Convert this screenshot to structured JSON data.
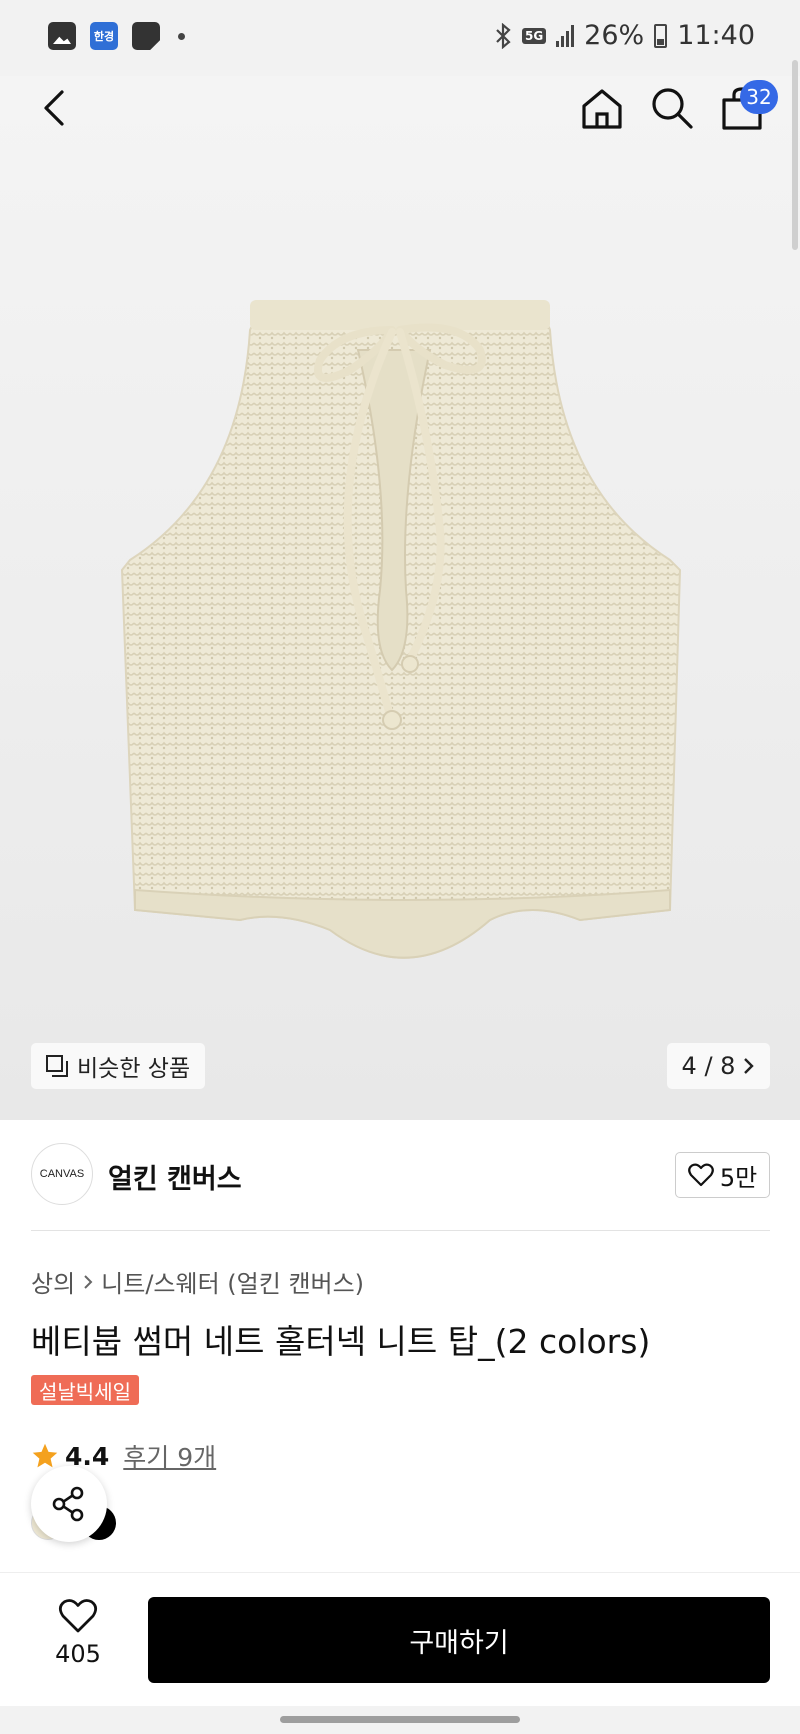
{
  "status_bar": {
    "hk_label": "한경",
    "network": "5G",
    "battery": "26%",
    "time": "11:40"
  },
  "header": {
    "cart_count": "32"
  },
  "gallery": {
    "similar_label": "비슷한 상품",
    "page_indicator": "4 / 8"
  },
  "brand": {
    "logo_text": "CANVAS",
    "name": "얼킨 캔버스",
    "likes": "5만"
  },
  "product": {
    "breadcrumb": [
      "상의",
      "니트/스웨터 (얼킨 캔버스)"
    ],
    "title": "베티붑 썸머 네트 홀터넥 니트 탑_(2 colors)",
    "sale_tag": "설날빅세일",
    "rating": "4.4",
    "reviews": "후기 9개",
    "swatches": [
      "#efe9d4",
      "#000000"
    ]
  },
  "bottom_bar": {
    "wish_count": "405",
    "buy_label": "구매하기"
  },
  "colors": {
    "badge": "#3569e6",
    "sale_tag": "#ef6c56",
    "star": "#f4a11e",
    "buy_button": "#000000"
  }
}
